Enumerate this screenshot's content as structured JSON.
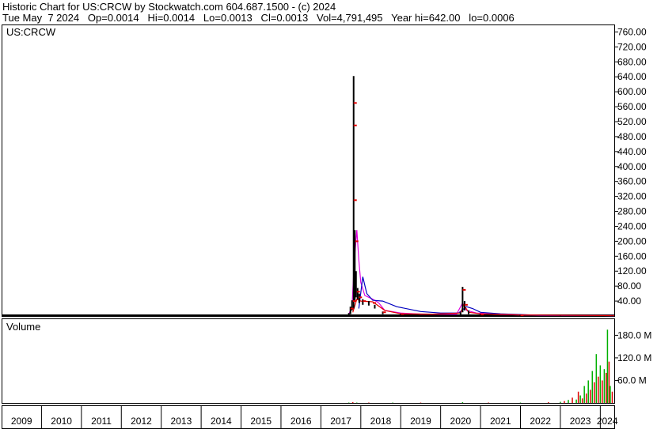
{
  "header": {
    "line1": "Historic Chart for US:CRCW by Stockwatch.com 604.687.1500 - (c) 2024",
    "line2": "Tue May  7 2024   Op=0.0014   Hi=0.0014   Lo=0.0013   Cl=0.0013   Vol=4,791,495   Year hi=642.00   lo=0.0006"
  },
  "chart_data": [
    {
      "type": "line",
      "title": "US:CRCW",
      "ylim": [
        0,
        780
      ],
      "y_ticks": [
        "40.00",
        "80.00",
        "120.00",
        "160.00",
        "200.00",
        "240.00",
        "280.00",
        "320.00",
        "360.00",
        "400.00",
        "440.00",
        "480.00",
        "520.00",
        "560.00",
        "600.00",
        "640.00",
        "680.00",
        "720.00",
        "760.00"
      ],
      "x_labels": [
        "2009",
        "2010",
        "2011",
        "2012",
        "2013",
        "2014",
        "2015",
        "2016",
        "2017",
        "2018",
        "2019",
        "2020",
        "2021",
        "2022",
        "2023",
        "2024"
      ],
      "x_start": 2009.0,
      "x_end": 2024.35,
      "price_high_low": [
        [
          2017.7,
          0,
          8
        ],
        [
          2017.74,
          5,
          25
        ],
        [
          2017.78,
          15,
          42
        ],
        [
          2017.82,
          20,
          642
        ],
        [
          2017.85,
          40,
          230
        ],
        [
          2017.88,
          50,
          120
        ],
        [
          2017.92,
          45,
          75
        ],
        [
          2017.96,
          35,
          60
        ],
        [
          2018.05,
          30,
          45
        ],
        [
          2018.2,
          28,
          40
        ],
        [
          2018.35,
          20,
          30
        ],
        [
          2018.55,
          5,
          12
        ],
        [
          2019.0,
          2,
          6
        ],
        [
          2020.5,
          3,
          10
        ],
        [
          2020.55,
          10,
          78
        ],
        [
          2020.6,
          15,
          40
        ],
        [
          2020.7,
          5,
          15
        ],
        [
          2021.0,
          2,
          6
        ],
        [
          2022.0,
          1,
          3
        ],
        [
          2023.0,
          0.5,
          1
        ],
        [
          2024.3,
          0,
          0.5
        ]
      ],
      "close_ticks": [
        [
          2017.74,
          20
        ],
        [
          2017.8,
          40
        ],
        [
          2017.82,
          570
        ],
        [
          2017.82,
          510
        ],
        [
          2017.82,
          310
        ],
        [
          2017.86,
          200
        ],
        [
          2017.9,
          65
        ],
        [
          2017.95,
          50
        ],
        [
          2018.05,
          40
        ],
        [
          2018.3,
          35
        ],
        [
          2018.55,
          10
        ],
        [
          2019.0,
          5
        ],
        [
          2020.55,
          70
        ],
        [
          2020.6,
          30
        ],
        [
          2021.0,
          4
        ],
        [
          2022.0,
          2
        ]
      ],
      "series": [
        {
          "color": "#e000e0",
          "points": [
            [
              2017.7,
              5
            ],
            [
              2017.78,
              25
            ],
            [
              2017.84,
              150
            ],
            [
              2017.9,
              230
            ],
            [
              2017.95,
              150
            ],
            [
              2018.0,
              90
            ],
            [
              2018.1,
              55
            ],
            [
              2018.3,
              45
            ],
            [
              2018.45,
              35
            ],
            [
              2018.6,
              15
            ],
            [
              2019.0,
              8
            ],
            [
              2019.5,
              5
            ],
            [
              2020.4,
              5
            ],
            [
              2020.55,
              35
            ],
            [
              2020.65,
              15
            ],
            [
              2020.9,
              8
            ],
            [
              2021.5,
              4
            ],
            [
              2022.5,
              2
            ],
            [
              2024.35,
              1
            ]
          ]
        },
        {
          "color": "#0000c0",
          "points": [
            [
              2017.95,
              20
            ],
            [
              2018.05,
              105
            ],
            [
              2018.15,
              60
            ],
            [
              2018.3,
              42
            ],
            [
              2018.55,
              40
            ],
            [
              2018.9,
              25
            ],
            [
              2019.5,
              12
            ],
            [
              2020.0,
              8
            ],
            [
              2020.45,
              8
            ],
            [
              2020.65,
              25
            ],
            [
              2020.8,
              20
            ],
            [
              2021.0,
              10
            ],
            [
              2021.5,
              6
            ],
            [
              2022.0,
              4
            ],
            [
              2022.5,
              2
            ],
            [
              2024.35,
              1
            ]
          ]
        },
        {
          "color": "#e00000",
          "points": [
            [
              2017.8,
              10
            ],
            [
              2017.9,
              45
            ],
            [
              2018.0,
              40
            ],
            [
              2018.3,
              38
            ],
            [
              2018.6,
              15
            ],
            [
              2019.0,
              6
            ],
            [
              2019.8,
              5
            ],
            [
              2020.5,
              8
            ],
            [
              2020.58,
              30
            ],
            [
              2020.7,
              10
            ],
            [
              2021.0,
              6
            ],
            [
              2022.0,
              3
            ],
            [
              2024.35,
              1
            ]
          ]
        }
      ]
    },
    {
      "type": "bar",
      "title": "Volume",
      "ylim": [
        0,
        225
      ],
      "y_ticks": [
        "60.0 M",
        "120.0 M",
        "180.0 M"
      ],
      "values_m": [
        [
          2017.7,
          1
        ],
        [
          2017.8,
          2
        ],
        [
          2017.9,
          1
        ],
        [
          2018.2,
          1
        ],
        [
          2018.8,
          1
        ],
        [
          2019.5,
          1
        ],
        [
          2020.55,
          2
        ],
        [
          2021.2,
          1
        ],
        [
          2022.0,
          1
        ],
        [
          2022.7,
          2
        ],
        [
          2023.0,
          3
        ],
        [
          2023.1,
          5
        ],
        [
          2023.2,
          8
        ],
        [
          2023.3,
          14
        ],
        [
          2023.4,
          9
        ],
        [
          2023.45,
          30
        ],
        [
          2023.5,
          20
        ],
        [
          2023.55,
          12
        ],
        [
          2023.6,
          45
        ],
        [
          2023.65,
          25
        ],
        [
          2023.7,
          60
        ],
        [
          2023.75,
          35
        ],
        [
          2023.8,
          85
        ],
        [
          2023.85,
          55
        ],
        [
          2023.9,
          130
        ],
        [
          2023.95,
          70
        ],
        [
          2024.0,
          100
        ],
        [
          2024.05,
          60
        ],
        [
          2024.1,
          90
        ],
        [
          2024.15,
          80
        ],
        [
          2024.18,
          195
        ],
        [
          2024.22,
          110
        ],
        [
          2024.25,
          45
        ],
        [
          2024.3,
          30
        ]
      ],
      "colors": [
        "#00b000",
        "#e00000"
      ]
    }
  ]
}
